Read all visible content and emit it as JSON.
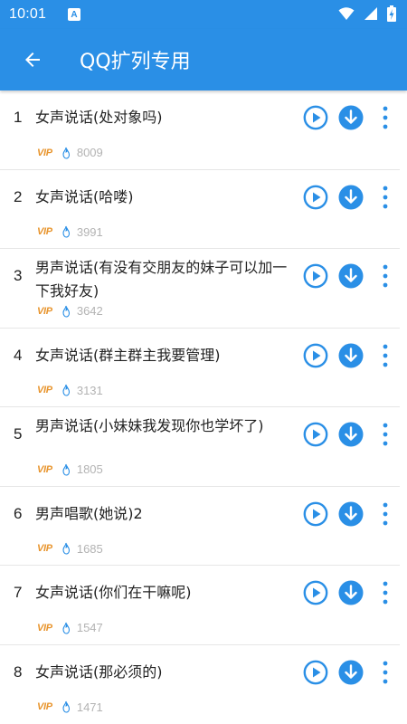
{
  "status_bar": {
    "time": "10:01",
    "notification_letter": "A"
  },
  "app_bar": {
    "title": "QQ扩列专用",
    "back_icon": "arrow-left-icon"
  },
  "colors": {
    "primary": "#2a8fe6",
    "vip": "#e8952e",
    "count": "#b3b3b3"
  },
  "items": [
    {
      "index": "1",
      "title": "女声说话(处对象吗)",
      "vip": "VIP",
      "count": "8009"
    },
    {
      "index": "2",
      "title": "女声说话(哈喽)",
      "vip": "VIP",
      "count": "3991"
    },
    {
      "index": "3",
      "title": "男声说话(有没有交朋友的妹子可以加一下我好友)",
      "vip": "VIP",
      "count": "3642"
    },
    {
      "index": "4",
      "title": "女声说话(群主群主我要管理)",
      "vip": "VIP",
      "count": "3131"
    },
    {
      "index": "5",
      "title": "男声说话(小妹妹我发现你也学坏了)",
      "vip": "VIP",
      "count": "1805"
    },
    {
      "index": "6",
      "title": "男声唱歌(她说)2",
      "vip": "VIP",
      "count": "1685"
    },
    {
      "index": "7",
      "title": "女声说话(你们在干嘛呢)",
      "vip": "VIP",
      "count": "1547"
    },
    {
      "index": "8",
      "title": "女声说话(那必须的)",
      "vip": "VIP",
      "count": "1471"
    }
  ]
}
